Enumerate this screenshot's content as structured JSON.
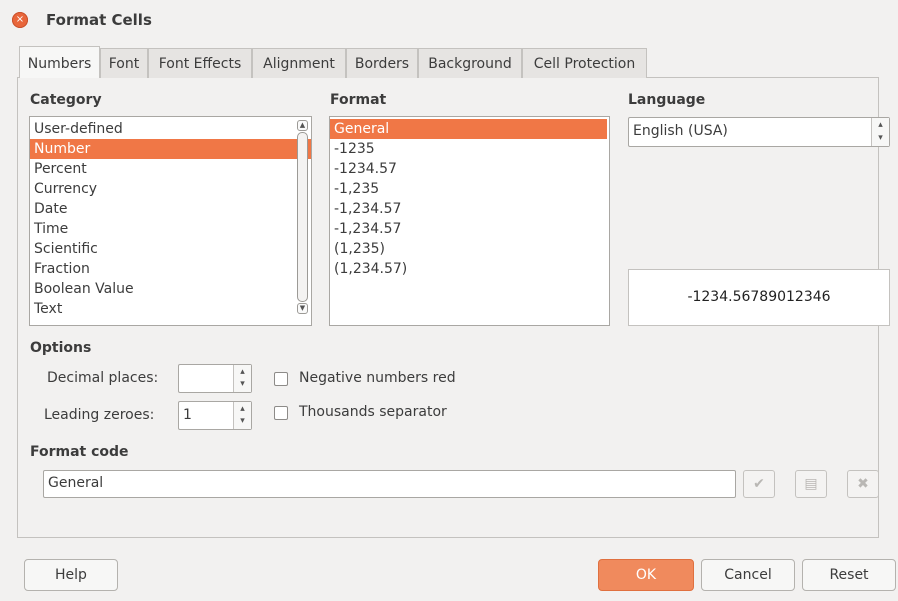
{
  "window": {
    "title": "Format Cells",
    "close_icon": "×"
  },
  "tabs": [
    {
      "label": "Numbers",
      "active": true
    },
    {
      "label": "Font",
      "active": false
    },
    {
      "label": "Font Effects",
      "active": false
    },
    {
      "label": "Alignment",
      "active": false
    },
    {
      "label": "Borders",
      "active": false
    },
    {
      "label": "Background",
      "active": false
    },
    {
      "label": "Cell Protection",
      "active": false
    }
  ],
  "category": {
    "heading": "Category",
    "items": [
      "User-defined",
      "Number",
      "Percent",
      "Currency",
      "Date",
      "Time",
      "Scientific",
      "Fraction",
      "Boolean Value",
      "Text"
    ],
    "selected": "Number"
  },
  "format": {
    "heading": "Format",
    "items": [
      "General",
      "-1235",
      "-1234.57",
      "-1,235",
      "-1,234.57",
      "-1,234.57",
      "(1,235)",
      "(1,234.57)"
    ],
    "selected": "General"
  },
  "language": {
    "heading": "Language",
    "value": "English (USA)"
  },
  "preview": {
    "text": "-1234.56789012346"
  },
  "options": {
    "heading": "Options",
    "decimal_places_label": "Decimal places:",
    "decimal_places_value": "",
    "leading_zeroes_label": "Leading zeroes:",
    "leading_zeroes_value": "1",
    "negative_red_label": "Negative numbers red",
    "negative_red_checked": false,
    "thousands_sep_label": "Thousands separator",
    "thousands_sep_checked": false
  },
  "format_code": {
    "heading": "Format code",
    "value": "General"
  },
  "buttons": {
    "help": "Help",
    "ok": "OK",
    "cancel": "Cancel",
    "reset": "Reset"
  },
  "colors": {
    "accent": "#f07746",
    "ok_button": "#f08a5d",
    "close_button": "#e8663b"
  },
  "icons": {
    "accept": "✔",
    "comment": "▤",
    "delete": "✖",
    "spin_up": "▴",
    "spin_down": "▾",
    "scroll_up": "▲",
    "scroll_down": "▼"
  }
}
